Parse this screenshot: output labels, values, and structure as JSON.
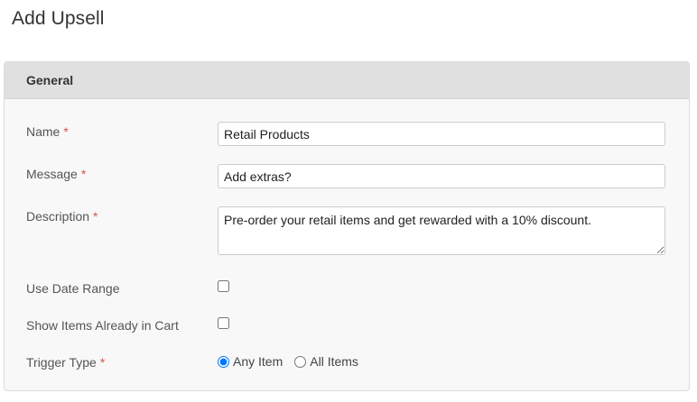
{
  "page": {
    "title": "Add Upsell"
  },
  "panel": {
    "title": "General"
  },
  "fields": {
    "name": {
      "label": "Name",
      "required_mark": "*",
      "value": "Retail Products"
    },
    "message": {
      "label": "Message",
      "required_mark": "*",
      "value": "Add extras?"
    },
    "description": {
      "label": "Description",
      "required_mark": "*",
      "value": "Pre-order your retail items and get rewarded with a 10% discount."
    },
    "use_date_range": {
      "label": "Use Date Range",
      "checked": false
    },
    "show_items_in_cart": {
      "label": "Show Items Already in Cart",
      "checked": false
    },
    "trigger_type": {
      "label": "Trigger Type",
      "required_mark": "*",
      "options": [
        {
          "label": "Any Item",
          "selected": true
        },
        {
          "label": "All Items",
          "selected": false
        }
      ]
    }
  },
  "colors": {
    "required": "#d9534f",
    "panel_header": "#e0e0e0",
    "panel_body": "#f8f8f8"
  }
}
